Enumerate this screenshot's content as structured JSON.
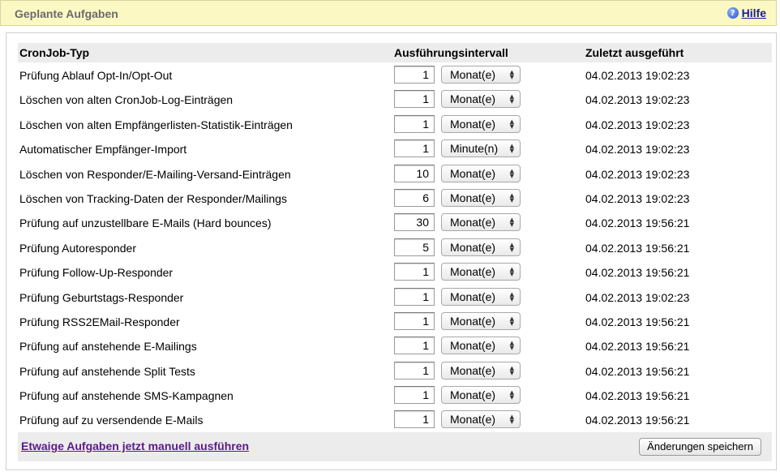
{
  "header": {
    "title": "Geplante Aufgaben",
    "help_label": "Hilfe"
  },
  "table": {
    "columns": {
      "type": "CronJob-Typ",
      "interval": "Ausführungsintervall",
      "last_run": "Zuletzt ausgeführt"
    },
    "rows": [
      {
        "type": "Prüfung Ablauf Opt-In/Opt-Out",
        "value": "1",
        "unit": "Monat(e)",
        "last_run": "04.02.2013 19:02:23"
      },
      {
        "type": "Löschen von alten CronJob-Log-Einträgen",
        "value": "1",
        "unit": "Monat(e)",
        "last_run": "04.02.2013 19:02:23"
      },
      {
        "type": "Löschen von alten Empfängerlisten-Statistik-Einträgen",
        "value": "1",
        "unit": "Monat(e)",
        "last_run": "04.02.2013 19:02:23"
      },
      {
        "type": "Automatischer Empfänger-Import",
        "value": "1",
        "unit": "Minute(n)",
        "last_run": "04.02.2013 19:02:23"
      },
      {
        "type": "Löschen von Responder/E-Mailing-Versand-Einträgen",
        "value": "10",
        "unit": "Monat(e)",
        "last_run": "04.02.2013 19:02:23"
      },
      {
        "type": "Löschen von Tracking-Daten der Responder/Mailings",
        "value": "6",
        "unit": "Monat(e)",
        "last_run": "04.02.2013 19:02:23"
      },
      {
        "type": "Prüfung auf unzustellbare E-Mails (Hard bounces)",
        "value": "30",
        "unit": "Monat(e)",
        "last_run": "04.02.2013 19:56:21"
      },
      {
        "type": "Prüfung Autoresponder",
        "value": "5",
        "unit": "Monat(e)",
        "last_run": "04.02.2013 19:56:21"
      },
      {
        "type": "Prüfung Follow-Up-Responder",
        "value": "1",
        "unit": "Monat(e)",
        "last_run": "04.02.2013 19:56:21"
      },
      {
        "type": "Prüfung Geburtstags-Responder",
        "value": "1",
        "unit": "Monat(e)",
        "last_run": "04.02.2013 19:02:23"
      },
      {
        "type": "Prüfung RSS2EMail-Responder",
        "value": "1",
        "unit": "Monat(e)",
        "last_run": "04.02.2013 19:56:21"
      },
      {
        "type": "Prüfung auf anstehende E-Mailings",
        "value": "1",
        "unit": "Monat(e)",
        "last_run": "04.02.2013 19:56:21"
      },
      {
        "type": "Prüfung auf anstehende Split Tests",
        "value": "1",
        "unit": "Monat(e)",
        "last_run": "04.02.2013 19:56:21"
      },
      {
        "type": "Prüfung auf anstehende SMS-Kampagnen",
        "value": "1",
        "unit": "Monat(e)",
        "last_run": "04.02.2013 19:56:21"
      },
      {
        "type": "Prüfung auf zu versendende E-Mails",
        "value": "1",
        "unit": "Monat(e)",
        "last_run": "04.02.2013 19:56:21"
      }
    ]
  },
  "footer": {
    "run_now_label": "Etwaige Aufgaben jetzt manuell ausführen",
    "save_label": "Änderungen speichern"
  },
  "icons": {
    "help": "help-icon",
    "select_arrows": "updown-arrows-icon"
  },
  "colors": {
    "header_bg": "#fbf8c3",
    "link": "#1a1aa6",
    "visited_link": "#5a1a8a",
    "row_header_bg": "#ececec"
  }
}
